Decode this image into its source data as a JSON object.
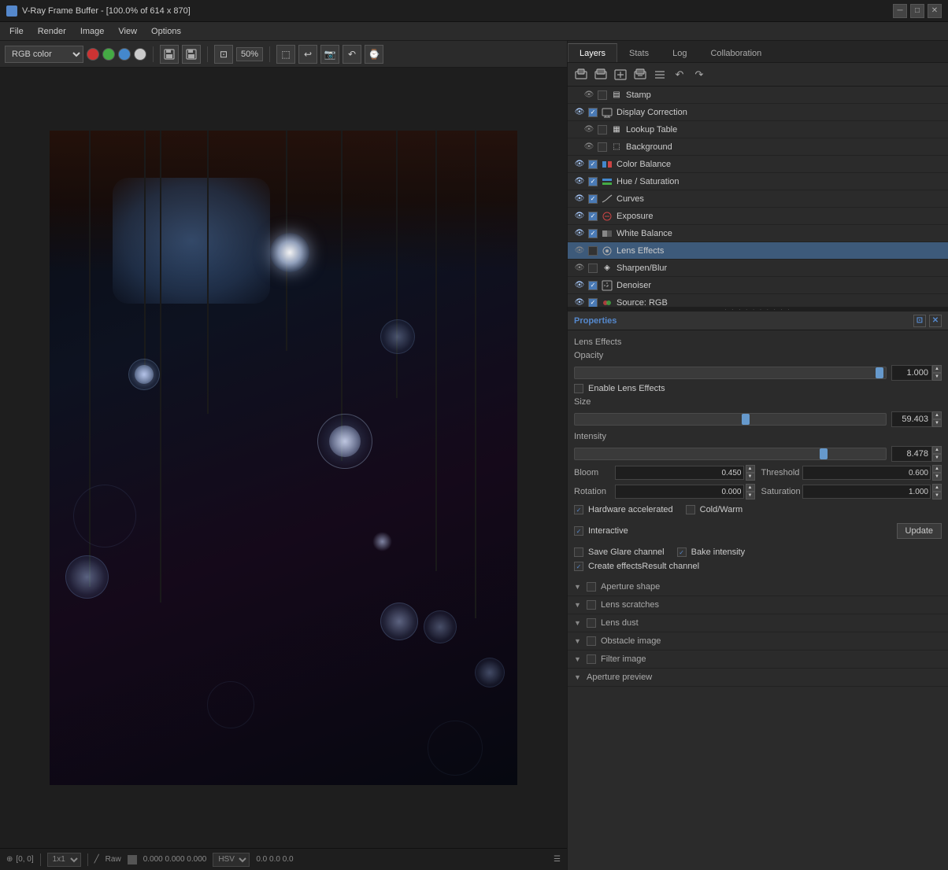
{
  "titlebar": {
    "title": "V-Ray Frame Buffer - [100.0% of 614 x 870]",
    "icon": "vray-icon"
  },
  "menubar": {
    "items": [
      "File",
      "Render",
      "Image",
      "View",
      "Options"
    ]
  },
  "toolbar": {
    "color_mode": "RGB color",
    "zoom": "50%",
    "colors": [
      {
        "name": "red-dot",
        "color": "#cc3333"
      },
      {
        "name": "green-dot",
        "color": "#44aa44"
      },
      {
        "name": "blue-dot",
        "color": "#4488cc"
      },
      {
        "name": "white-dot",
        "color": "#cccccc"
      }
    ]
  },
  "tabs": {
    "items": [
      "Layers",
      "Stats",
      "Log",
      "Collaboration"
    ],
    "active": 0
  },
  "layers": {
    "items": [
      {
        "id": 1,
        "name": "Stamp",
        "visible": false,
        "enabled": false,
        "indent": 1,
        "icon": "stamp"
      },
      {
        "id": 2,
        "name": "Display Correction",
        "visible": true,
        "enabled": true,
        "indent": 0,
        "icon": "display"
      },
      {
        "id": 3,
        "name": "Lookup Table",
        "visible": false,
        "enabled": false,
        "indent": 1,
        "icon": "table"
      },
      {
        "id": 4,
        "name": "Background",
        "visible": false,
        "enabled": false,
        "indent": 1,
        "icon": "bg"
      },
      {
        "id": 5,
        "name": "Color Balance",
        "visible": true,
        "enabled": true,
        "indent": 0,
        "icon": "balance"
      },
      {
        "id": 6,
        "name": "Hue / Saturation",
        "visible": true,
        "enabled": true,
        "indent": 0,
        "icon": "hue"
      },
      {
        "id": 7,
        "name": "Curves",
        "visible": true,
        "enabled": true,
        "indent": 0,
        "icon": "curves"
      },
      {
        "id": 8,
        "name": "Exposure",
        "visible": true,
        "enabled": true,
        "indent": 0,
        "icon": "exposure"
      },
      {
        "id": 9,
        "name": "White Balance",
        "visible": true,
        "enabled": true,
        "indent": 0,
        "icon": "wb"
      },
      {
        "id": 10,
        "name": "Lens Effects",
        "visible": false,
        "enabled": false,
        "indent": 0,
        "icon": "lens",
        "selected": true
      },
      {
        "id": 11,
        "name": "Sharpen/Blur",
        "visible": false,
        "enabled": false,
        "indent": 0,
        "icon": "sharpen"
      },
      {
        "id": 12,
        "name": "Denoiser",
        "visible": true,
        "enabled": true,
        "indent": 0,
        "icon": "denoiser"
      },
      {
        "id": 13,
        "name": "Source: RGB",
        "visible": true,
        "enabled": true,
        "indent": 0,
        "icon": "source"
      }
    ]
  },
  "properties": {
    "title": "Properties",
    "section_label": "Lens Effects",
    "opacity_label": "Opacity",
    "opacity_value": "1.000",
    "opacity_thumb_pct": 98,
    "enable_label": "Enable Lens Effects",
    "size_label": "Size",
    "size_value": "59.403",
    "size_thumb_pct": 55,
    "intensity_label": "Intensity",
    "intensity_value": "8.478",
    "intensity_thumb_pct": 80,
    "bloom_label": "Bloom",
    "bloom_value": "0.450",
    "threshold_label": "Threshold",
    "threshold_value": "0.600",
    "rotation_label": "Rotation",
    "rotation_value": "0.000",
    "saturation_label": "Saturation",
    "saturation_value": "1.000",
    "hw_accel_label": "Hardware accelerated",
    "cold_warm_label": "Cold/Warm",
    "interactive_label": "Interactive",
    "save_glare_label": "Save Glare channel",
    "bake_intensity_label": "Bake intensity",
    "create_effects_label": "Create effectsResult channel",
    "update_btn": "Update",
    "sections": [
      {
        "label": "Aperture shape",
        "collapsed": true
      },
      {
        "label": "Lens scratches",
        "collapsed": true
      },
      {
        "label": "Lens dust",
        "collapsed": true
      },
      {
        "label": "Obstacle image",
        "collapsed": true
      },
      {
        "label": "Filter image",
        "collapsed": true
      },
      {
        "label": "Aperture preview",
        "collapsed": true
      }
    ]
  },
  "statusbar": {
    "coords": "[0, 0]",
    "zoom_level": "1x1",
    "raw_label": "Raw",
    "values": "0.000  0.000  0.000",
    "color_mode": "HSV",
    "extra_values": "0.0  0.0  0.0"
  }
}
